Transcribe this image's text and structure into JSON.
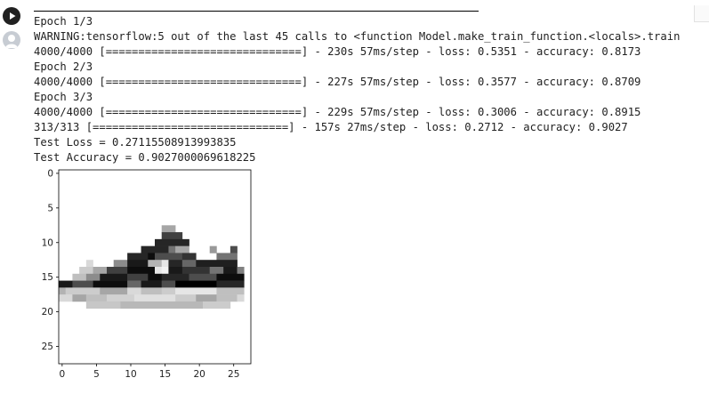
{
  "cell": {
    "run_icon": "play-circle-icon",
    "avatar_icon": "user-avatar-icon",
    "output_lines": [
      "Epoch 1/3",
      "WARNING:tensorflow:5 out of the last 45 calls to <function Model.make_train_function.<locals>.train",
      "4000/4000 [==============================] - 230s 57ms/step - loss: 0.5351 - accuracy: 0.8173",
      "Epoch 2/3",
      "4000/4000 [==============================] - 227s 57ms/step - loss: 0.3577 - accuracy: 0.8709",
      "Epoch 3/3",
      "4000/4000 [==============================] - 229s 57ms/step - loss: 0.3006 - accuracy: 0.8915",
      "313/313 [==============================] - 157s 27ms/step - loss: 0.2712 - accuracy: 0.9027",
      "Test Loss = 0.27115508913993835",
      "Test Accuracy = 0.9027000069618225"
    ]
  },
  "chart_data": {
    "type": "heatmap",
    "colormap": "gray_r",
    "xticks": [
      0,
      5,
      10,
      15,
      20,
      25
    ],
    "yticks": [
      0,
      5,
      10,
      15,
      20,
      25
    ],
    "xlim": [
      -0.5,
      27.5
    ],
    "ylim": [
      27.5,
      -0.5
    ],
    "rows": 28,
    "cols": 28,
    "pixels": [
      [
        8,
        15,
        2,
        0.35
      ],
      [
        9,
        15,
        3,
        0.75
      ],
      [
        10,
        14,
        5,
        0.85
      ],
      [
        11,
        12,
        4,
        0.85
      ],
      [
        11,
        16,
        1,
        0.55
      ],
      [
        11,
        17,
        2,
        0.35
      ],
      [
        11,
        22,
        1,
        0.4
      ],
      [
        11,
        25,
        1,
        0.7
      ],
      [
        12,
        10,
        3,
        0.85
      ],
      [
        12,
        13,
        1,
        0.95
      ],
      [
        12,
        14,
        4,
        0.7
      ],
      [
        12,
        18,
        2,
        0.8
      ],
      [
        12,
        23,
        3,
        0.55
      ],
      [
        13,
        4,
        1,
        0.15
      ],
      [
        13,
        8,
        2,
        0.45
      ],
      [
        13,
        10,
        3,
        0.9
      ],
      [
        13,
        13,
        2,
        0.3
      ],
      [
        13,
        15,
        1,
        0.1
      ],
      [
        13,
        16,
        2,
        0.85
      ],
      [
        13,
        18,
        2,
        0.6
      ],
      [
        13,
        20,
        6,
        0.88
      ],
      [
        14,
        3,
        2,
        0.2
      ],
      [
        14,
        5,
        2,
        0.35
      ],
      [
        14,
        7,
        3,
        0.75
      ],
      [
        14,
        10,
        4,
        0.95
      ],
      [
        14,
        14,
        1,
        0.1
      ],
      [
        14,
        15,
        1,
        0.05
      ],
      [
        14,
        16,
        2,
        0.9
      ],
      [
        14,
        18,
        4,
        0.8
      ],
      [
        14,
        22,
        2,
        0.55
      ],
      [
        14,
        24,
        2,
        0.9
      ],
      [
        14,
        26,
        1,
        0.5
      ],
      [
        15,
        2,
        2,
        0.25
      ],
      [
        15,
        4,
        2,
        0.45
      ],
      [
        15,
        6,
        4,
        0.9
      ],
      [
        15,
        10,
        3,
        0.75
      ],
      [
        15,
        13,
        2,
        0.95
      ],
      [
        15,
        15,
        4,
        0.85
      ],
      [
        15,
        19,
        4,
        0.7
      ],
      [
        15,
        23,
        4,
        0.95
      ],
      [
        16,
        0,
        2,
        0.9
      ],
      [
        16,
        2,
        3,
        0.7
      ],
      [
        16,
        5,
        5,
        0.95
      ],
      [
        16,
        10,
        2,
        0.6
      ],
      [
        16,
        12,
        3,
        0.9
      ],
      [
        16,
        15,
        2,
        0.7
      ],
      [
        16,
        17,
        6,
        1.0
      ],
      [
        16,
        23,
        4,
        0.85
      ],
      [
        17,
        0,
        1,
        0.3
      ],
      [
        17,
        1,
        5,
        0.2
      ],
      [
        17,
        6,
        4,
        0.35
      ],
      [
        17,
        10,
        2,
        0.15
      ],
      [
        17,
        12,
        3,
        0.25
      ],
      [
        17,
        15,
        2,
        0.2
      ],
      [
        17,
        17,
        6,
        0.1
      ],
      [
        17,
        23,
        4,
        0.25
      ],
      [
        18,
        0,
        2,
        0.15
      ],
      [
        18,
        2,
        2,
        0.35
      ],
      [
        18,
        4,
        3,
        0.25
      ],
      [
        18,
        7,
        4,
        0.18
      ],
      [
        18,
        11,
        6,
        0.12
      ],
      [
        18,
        17,
        3,
        0.2
      ],
      [
        18,
        20,
        3,
        0.35
      ],
      [
        18,
        23,
        3,
        0.25
      ],
      [
        18,
        26,
        1,
        0.15
      ],
      [
        19,
        4,
        5,
        0.22
      ],
      [
        19,
        9,
        12,
        0.28
      ],
      [
        19,
        21,
        4,
        0.2
      ]
    ]
  }
}
